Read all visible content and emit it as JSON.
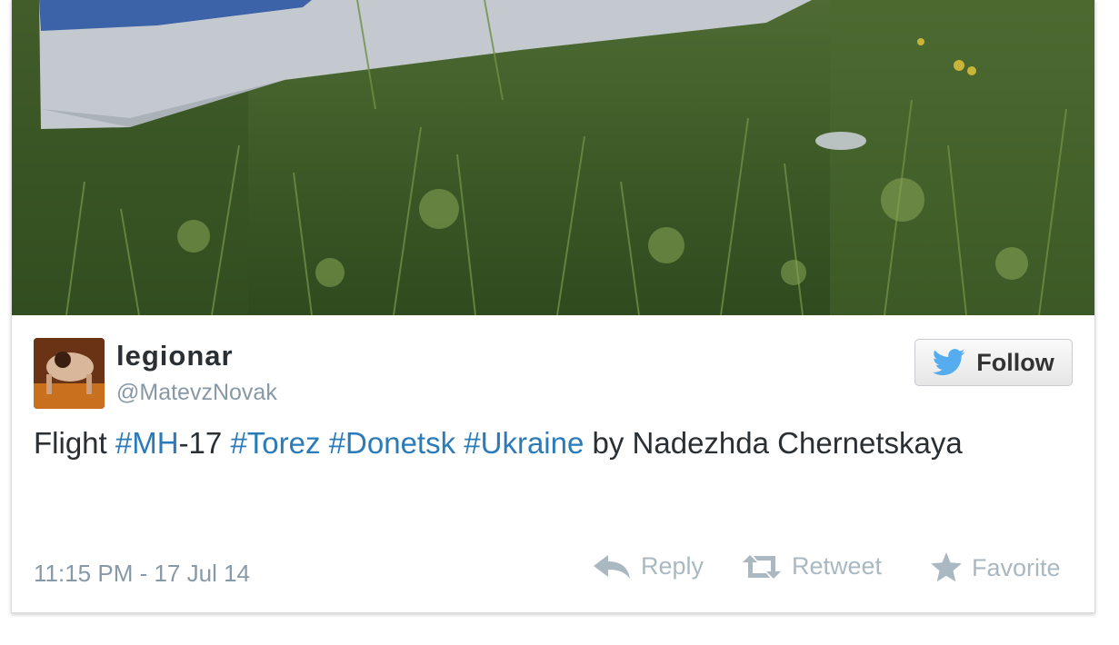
{
  "tweet": {
    "display_name": "legionar",
    "handle": "@MatevzNovak",
    "follow_label": "Follow",
    "text": {
      "prefix": "Flight ",
      "tag_mh": "#MH",
      "suffix_17": "-17 ",
      "tag_torez": "#Torez",
      "tag_donetsk": "#Donetsk",
      "tag_ukraine": "#Ukraine",
      "rest": " by Nadezhda Chernetskaya"
    },
    "timestamp": "11:15 PM - 17 Jul 14",
    "actions": {
      "reply": "Reply",
      "retweet": "Retweet",
      "favorite": "Favorite"
    }
  },
  "colors": {
    "hashtag": "#2b7bb9",
    "follow_bird": "#55acee",
    "muted": "#8899a6"
  },
  "icons": [
    "twitter-bird-icon",
    "reply-icon",
    "retweet-icon",
    "favorite-star-icon"
  ]
}
